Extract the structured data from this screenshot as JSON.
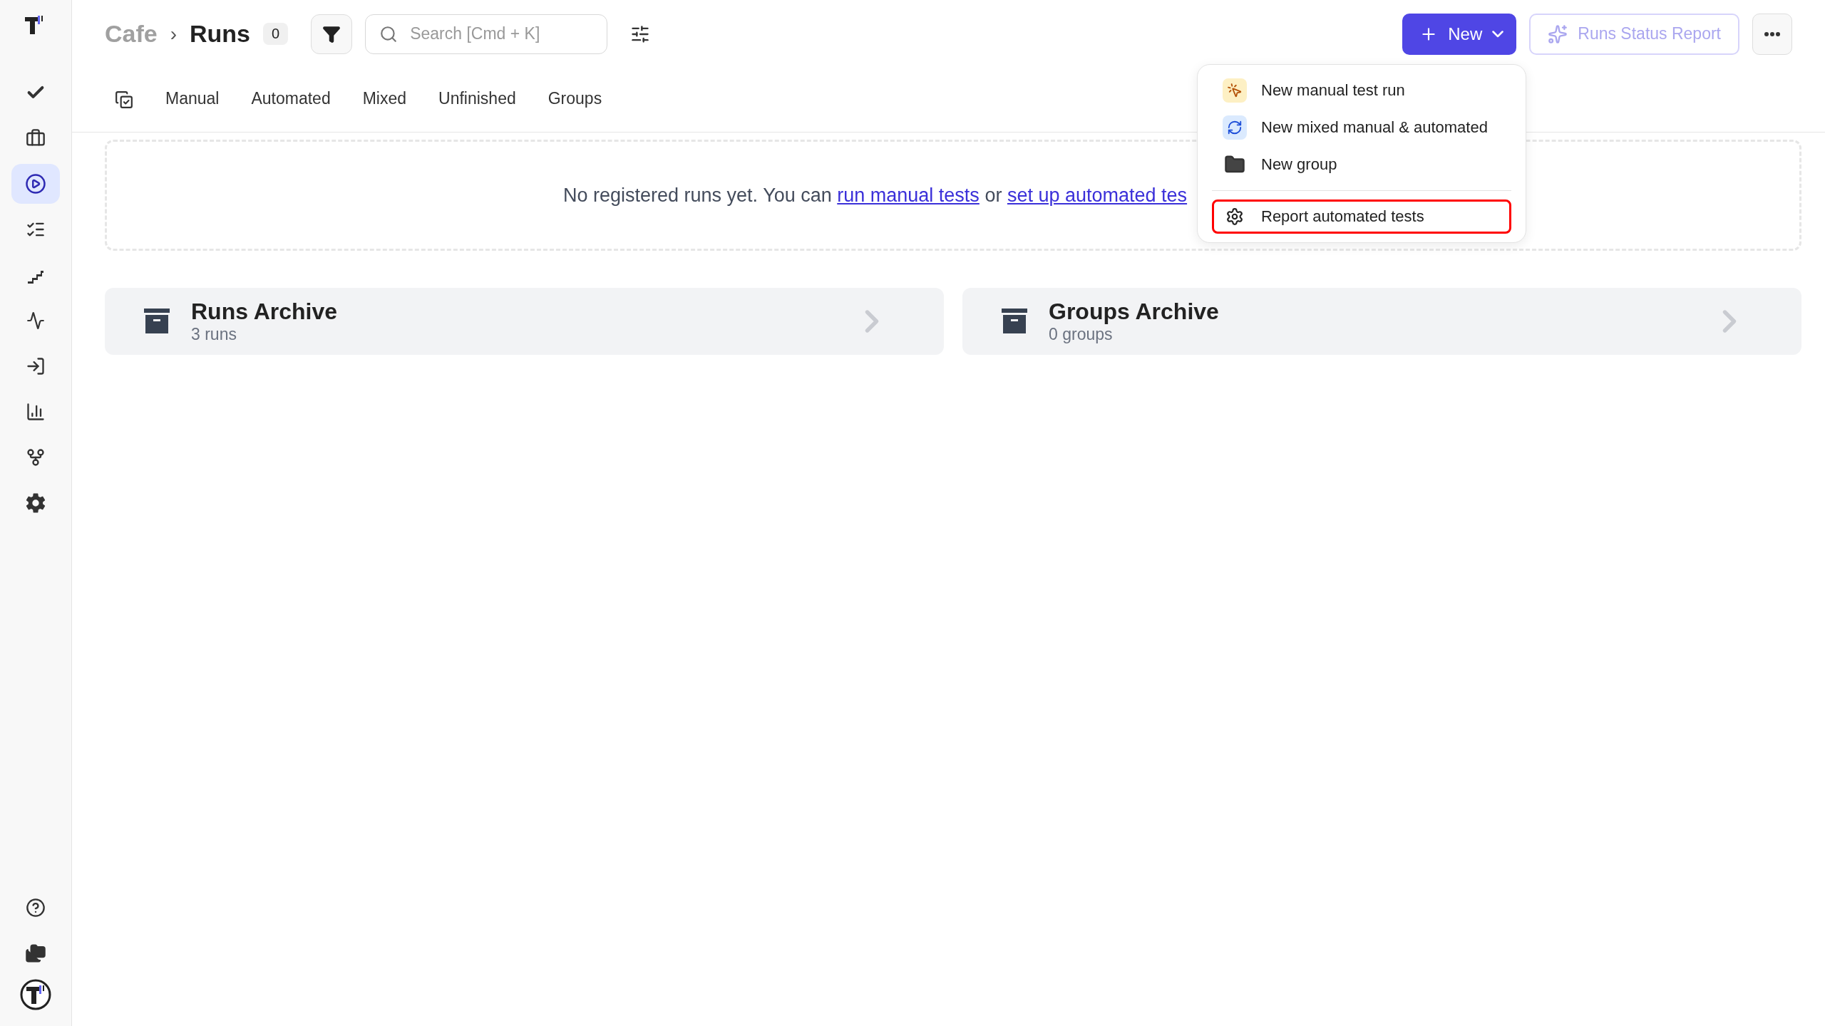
{
  "sidebar": {
    "items": [
      {
        "selected": false
      },
      {
        "selected": false
      },
      {
        "selected": true
      },
      {
        "selected": false
      },
      {
        "selected": false
      },
      {
        "selected": false
      },
      {
        "selected": false
      },
      {
        "selected": false
      },
      {
        "selected": false
      },
      {
        "selected": false
      }
    ],
    "bottom_items": [
      {
        "selected": false
      },
      {
        "selected": false
      }
    ]
  },
  "breadcrumb": {
    "parent": "Cafe",
    "separator": "›",
    "current": "Runs",
    "count": "0"
  },
  "search": {
    "placeholder": "Search [Cmd + K]"
  },
  "new_button": {
    "label": "New"
  },
  "report_button": {
    "label": "Runs Status Report",
    "disabled": true
  },
  "tabs": [
    {
      "label": "Manual",
      "selected": false
    },
    {
      "label": "Automated",
      "selected": false
    },
    {
      "label": "Mixed",
      "selected": false
    },
    {
      "label": "Unfinished",
      "selected": false
    },
    {
      "label": "Groups",
      "selected": false
    }
  ],
  "empty_message": {
    "text": "No registered runs yet. You can",
    "link_1": "run manual tests",
    "joiner": "or",
    "link_2": "set up automated tes"
  },
  "archives": [
    {
      "title": "Runs Archive",
      "subtitle": "3 runs"
    },
    {
      "title": "Groups Archive",
      "subtitle": "0 groups"
    }
  ],
  "menu": {
    "items": [
      {
        "kind": "manual",
        "label": "New manual test run",
        "selected": false
      },
      {
        "kind": "mixed",
        "label": "New mixed manual & automated",
        "selected": false
      },
      {
        "kind": "group",
        "label": "New group",
        "selected": false
      },
      {
        "kind": "report",
        "label": "Report automated tests",
        "selected": true
      }
    ]
  }
}
